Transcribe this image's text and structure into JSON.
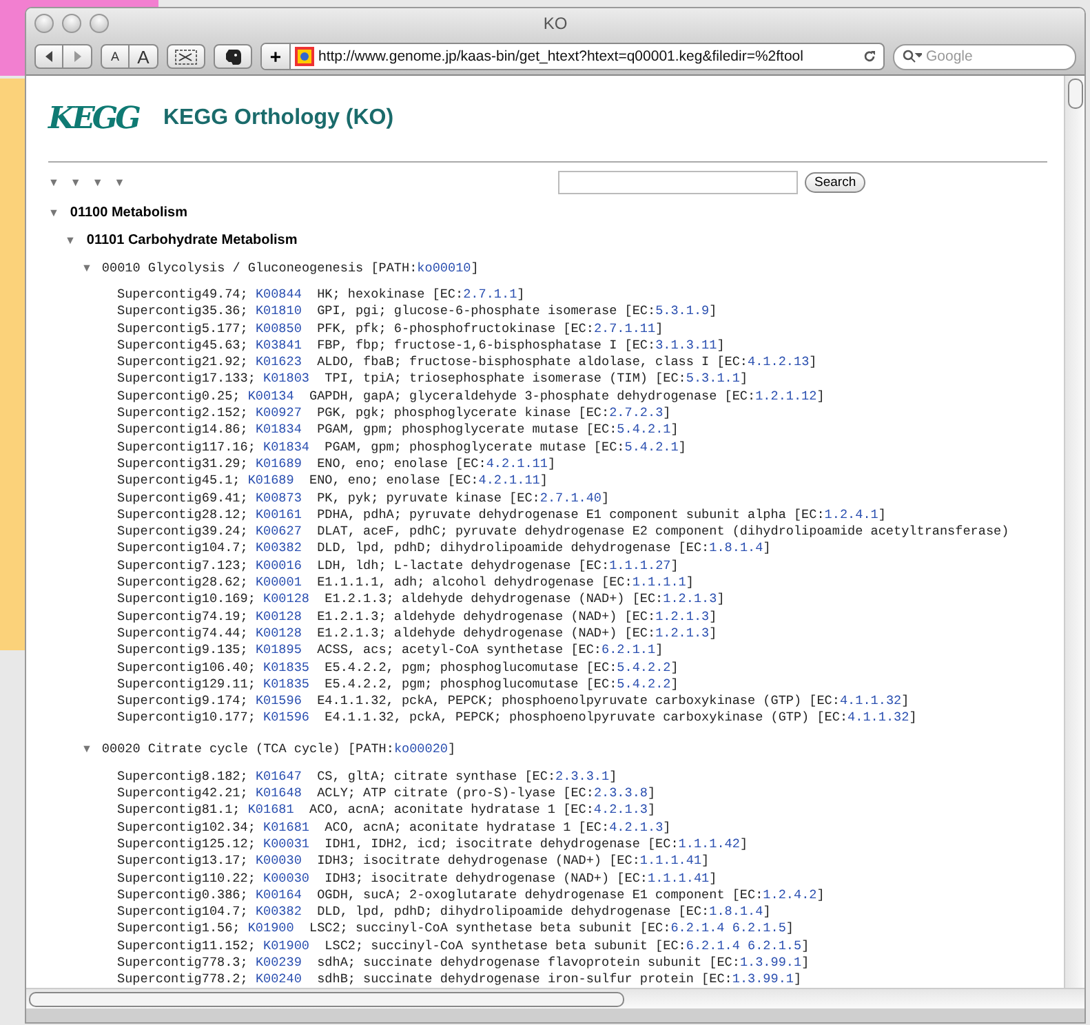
{
  "window": {
    "title": "KO"
  },
  "toolbar": {
    "text_smaller": "A",
    "text_bigger": "A",
    "add": "+",
    "url": "http://www.genome.jp/kaas-bin/get_htext?htext=q00001.keg&filedir=%2ftool",
    "search_placeholder": "Google"
  },
  "page": {
    "logo": "KEGG",
    "title": "KEGG Orthology (KO)",
    "level_toggles": [
      "▼",
      "▼",
      "▼",
      "▼"
    ],
    "search_button": "Search",
    "tree": [
      {
        "toggle": "▼",
        "label": "01100 Metabolism",
        "expanded": true,
        "children": [
          {
            "toggle": "▼",
            "label": "01101 Carbohydrate Metabolism",
            "expanded": true,
            "pathways": [
              {
                "toggle": "▼",
                "label": "00010 Glycolysis / Gluconeogenesis [PATH:",
                "path": "ko00010",
                "tail": "]",
                "expanded": true,
                "genes": [
                  {
                    "contig": "Supercontig49.74;",
                    "ko": "K00844",
                    "desc": "HK; hexokinase [EC:",
                    "ec": [
                      "2.7.1.1"
                    ],
                    "tail": "]"
                  },
                  {
                    "contig": "Supercontig35.36;",
                    "ko": "K01810",
                    "desc": "GPI, pgi; glucose-6-phosphate isomerase [EC:",
                    "ec": [
                      "5.3.1.9"
                    ],
                    "tail": "]"
                  },
                  {
                    "contig": "Supercontig5.177;",
                    "ko": "K00850",
                    "desc": "PFK, pfk; 6-phosphofructokinase [EC:",
                    "ec": [
                      "2.7.1.11"
                    ],
                    "tail": "]"
                  },
                  {
                    "contig": "Supercontig45.63;",
                    "ko": "K03841",
                    "desc": "FBP, fbp; fructose-1,6-bisphosphatase I [EC:",
                    "ec": [
                      "3.1.3.11"
                    ],
                    "tail": "]"
                  },
                  {
                    "contig": "Supercontig21.92;",
                    "ko": "K01623",
                    "desc": "ALDO, fbaB; fructose-bisphosphate aldolase, class I [EC:",
                    "ec": [
                      "4.1.2.13"
                    ],
                    "tail": "]"
                  },
                  {
                    "contig": "Supercontig17.133;",
                    "ko": "K01803",
                    "desc": "TPI, tpiA; triosephosphate isomerase (TIM) [EC:",
                    "ec": [
                      "5.3.1.1"
                    ],
                    "tail": "]"
                  },
                  {
                    "contig": "Supercontig0.25;",
                    "ko": "K00134",
                    "desc": "GAPDH, gapA; glyceraldehyde 3-phosphate dehydrogenase [EC:",
                    "ec": [
                      "1.2.1.12"
                    ],
                    "tail": "]"
                  },
                  {
                    "contig": "Supercontig2.152;",
                    "ko": "K00927",
                    "desc": "PGK, pgk; phosphoglycerate kinase [EC:",
                    "ec": [
                      "2.7.2.3"
                    ],
                    "tail": "]"
                  },
                  {
                    "contig": "Supercontig14.86;",
                    "ko": "K01834",
                    "desc": "PGAM, gpm; phosphoglycerate mutase [EC:",
                    "ec": [
                      "5.4.2.1"
                    ],
                    "tail": "]"
                  },
                  {
                    "contig": "Supercontig117.16;",
                    "ko": "K01834",
                    "desc": "PGAM, gpm; phosphoglycerate mutase [EC:",
                    "ec": [
                      "5.4.2.1"
                    ],
                    "tail": "]"
                  },
                  {
                    "contig": "Supercontig31.29;",
                    "ko": "K01689",
                    "desc": "ENO, eno; enolase [EC:",
                    "ec": [
                      "4.2.1.11"
                    ],
                    "tail": "]"
                  },
                  {
                    "contig": "Supercontig45.1;",
                    "ko": "K01689",
                    "desc": "ENO, eno; enolase [EC:",
                    "ec": [
                      "4.2.1.11"
                    ],
                    "tail": "]"
                  },
                  {
                    "contig": "Supercontig69.41;",
                    "ko": "K00873",
                    "desc": "PK, pyk; pyruvate kinase [EC:",
                    "ec": [
                      "2.7.1.40"
                    ],
                    "tail": "]"
                  },
                  {
                    "contig": "Supercontig28.12;",
                    "ko": "K00161",
                    "desc": "PDHA, pdhA; pyruvate dehydrogenase E1 component subunit alpha [EC:",
                    "ec": [
                      "1.2.4.1"
                    ],
                    "tail": "]"
                  },
                  {
                    "contig": "Supercontig39.24;",
                    "ko": "K00627",
                    "desc": "DLAT, aceF, pdhC; pyruvate dehydrogenase E2 component (dihydrolipoamide acetyltransferase)"
                  },
                  {
                    "contig": "Supercontig104.7;",
                    "ko": "K00382",
                    "desc": "DLD, lpd, pdhD; dihydrolipoamide dehydrogenase [EC:",
                    "ec": [
                      "1.8.1.4"
                    ],
                    "tail": "]"
                  },
                  {
                    "contig": "Supercontig7.123;",
                    "ko": "K00016",
                    "desc": "LDH, ldh; L-lactate dehydrogenase [EC:",
                    "ec": [
                      "1.1.1.27"
                    ],
                    "tail": "]"
                  },
                  {
                    "contig": "Supercontig28.62;",
                    "ko": "K00001",
                    "desc": "E1.1.1.1, adh; alcohol dehydrogenase [EC:",
                    "ec": [
                      "1.1.1.1"
                    ],
                    "tail": "]"
                  },
                  {
                    "contig": "Supercontig10.169;",
                    "ko": "K00128",
                    "desc": "E1.2.1.3; aldehyde dehydrogenase (NAD+) [EC:",
                    "ec": [
                      "1.2.1.3"
                    ],
                    "tail": "]"
                  },
                  {
                    "contig": "Supercontig74.19;",
                    "ko": "K00128",
                    "desc": "E1.2.1.3; aldehyde dehydrogenase (NAD+) [EC:",
                    "ec": [
                      "1.2.1.3"
                    ],
                    "tail": "]"
                  },
                  {
                    "contig": "Supercontig74.44;",
                    "ko": "K00128",
                    "desc": "E1.2.1.3; aldehyde dehydrogenase (NAD+) [EC:",
                    "ec": [
                      "1.2.1.3"
                    ],
                    "tail": "]"
                  },
                  {
                    "contig": "Supercontig9.135;",
                    "ko": "K01895",
                    "desc": "ACSS, acs; acetyl-CoA synthetase [EC:",
                    "ec": [
                      "6.2.1.1"
                    ],
                    "tail": "]"
                  },
                  {
                    "contig": "Supercontig106.40;",
                    "ko": "K01835",
                    "desc": "E5.4.2.2, pgm; phosphoglucomutase [EC:",
                    "ec": [
                      "5.4.2.2"
                    ],
                    "tail": "]"
                  },
                  {
                    "contig": "Supercontig129.11;",
                    "ko": "K01835",
                    "desc": "E5.4.2.2, pgm; phosphoglucomutase [EC:",
                    "ec": [
                      "5.4.2.2"
                    ],
                    "tail": "]"
                  },
                  {
                    "contig": "Supercontig9.174;",
                    "ko": "K01596",
                    "desc": "E4.1.1.32, pckA, PEPCK; phosphoenolpyruvate carboxykinase (GTP) [EC:",
                    "ec": [
                      "4.1.1.32"
                    ],
                    "tail": "]"
                  },
                  {
                    "contig": "Supercontig10.177;",
                    "ko": "K01596",
                    "desc": "E4.1.1.32, pckA, PEPCK; phosphoenolpyruvate carboxykinase (GTP) [EC:",
                    "ec": [
                      "4.1.1.32"
                    ],
                    "tail": "]"
                  }
                ]
              },
              {
                "toggle": "▼",
                "label": "00020 Citrate cycle (TCA cycle) [PATH:",
                "path": "ko00020",
                "tail": "]",
                "expanded": true,
                "genes": [
                  {
                    "contig": "Supercontig8.182;",
                    "ko": "K01647",
                    "desc": "CS, gltA; citrate synthase [EC:",
                    "ec": [
                      "2.3.3.1"
                    ],
                    "tail": "]"
                  },
                  {
                    "contig": "Supercontig42.21;",
                    "ko": "K01648",
                    "desc": "ACLY; ATP citrate (pro-S)-lyase [EC:",
                    "ec": [
                      "2.3.3.8"
                    ],
                    "tail": "]"
                  },
                  {
                    "contig": "Supercontig81.1;",
                    "ko": "K01681",
                    "desc": "ACO, acnA; aconitate hydratase 1 [EC:",
                    "ec": [
                      "4.2.1.3"
                    ],
                    "tail": "]"
                  },
                  {
                    "contig": "Supercontig102.34;",
                    "ko": "K01681",
                    "desc": "ACO, acnA; aconitate hydratase 1 [EC:",
                    "ec": [
                      "4.2.1.3"
                    ],
                    "tail": "]"
                  },
                  {
                    "contig": "Supercontig125.12;",
                    "ko": "K00031",
                    "desc": "IDH1, IDH2, icd; isocitrate dehydrogenase [EC:",
                    "ec": [
                      "1.1.1.42"
                    ],
                    "tail": "]"
                  },
                  {
                    "contig": "Supercontig13.17;",
                    "ko": "K00030",
                    "desc": "IDH3; isocitrate dehydrogenase (NAD+) [EC:",
                    "ec": [
                      "1.1.1.41"
                    ],
                    "tail": "]"
                  },
                  {
                    "contig": "Supercontig110.22;",
                    "ko": "K00030",
                    "desc": "IDH3; isocitrate dehydrogenase (NAD+) [EC:",
                    "ec": [
                      "1.1.1.41"
                    ],
                    "tail": "]"
                  },
                  {
                    "contig": "Supercontig0.386;",
                    "ko": "K00164",
                    "desc": "OGDH, sucA; 2-oxoglutarate dehydrogenase E1 component [EC:",
                    "ec": [
                      "1.2.4.2"
                    ],
                    "tail": "]"
                  },
                  {
                    "contig": "Supercontig104.7;",
                    "ko": "K00382",
                    "desc": "DLD, lpd, pdhD; dihydrolipoamide dehydrogenase [EC:",
                    "ec": [
                      "1.8.1.4"
                    ],
                    "tail": "]"
                  },
                  {
                    "contig": "Supercontig1.56;",
                    "ko": "K01900",
                    "desc": "LSC2; succinyl-CoA synthetase beta subunit [EC:",
                    "ec": [
                      "6.2.1.4",
                      "6.2.1.5"
                    ],
                    "tail": "]"
                  },
                  {
                    "contig": "Supercontig11.152;",
                    "ko": "K01900",
                    "desc": "LSC2; succinyl-CoA synthetase beta subunit [EC:",
                    "ec": [
                      "6.2.1.4",
                      "6.2.1.5"
                    ],
                    "tail": "]"
                  },
                  {
                    "contig": "Supercontig778.3;",
                    "ko": "K00239",
                    "desc": "sdhA; succinate dehydrogenase flavoprotein subunit [EC:",
                    "ec": [
                      "1.3.99.1"
                    ],
                    "tail": "]"
                  },
                  {
                    "contig": "Supercontig778.2;",
                    "ko": "K00240",
                    "desc": "sdhB; succinate dehydrogenase iron-sulfur protein [EC:",
                    "ec": [
                      "1.3.99.1"
                    ],
                    "tail": "]"
                  }
                ]
              }
            ]
          }
        ]
      }
    ]
  }
}
